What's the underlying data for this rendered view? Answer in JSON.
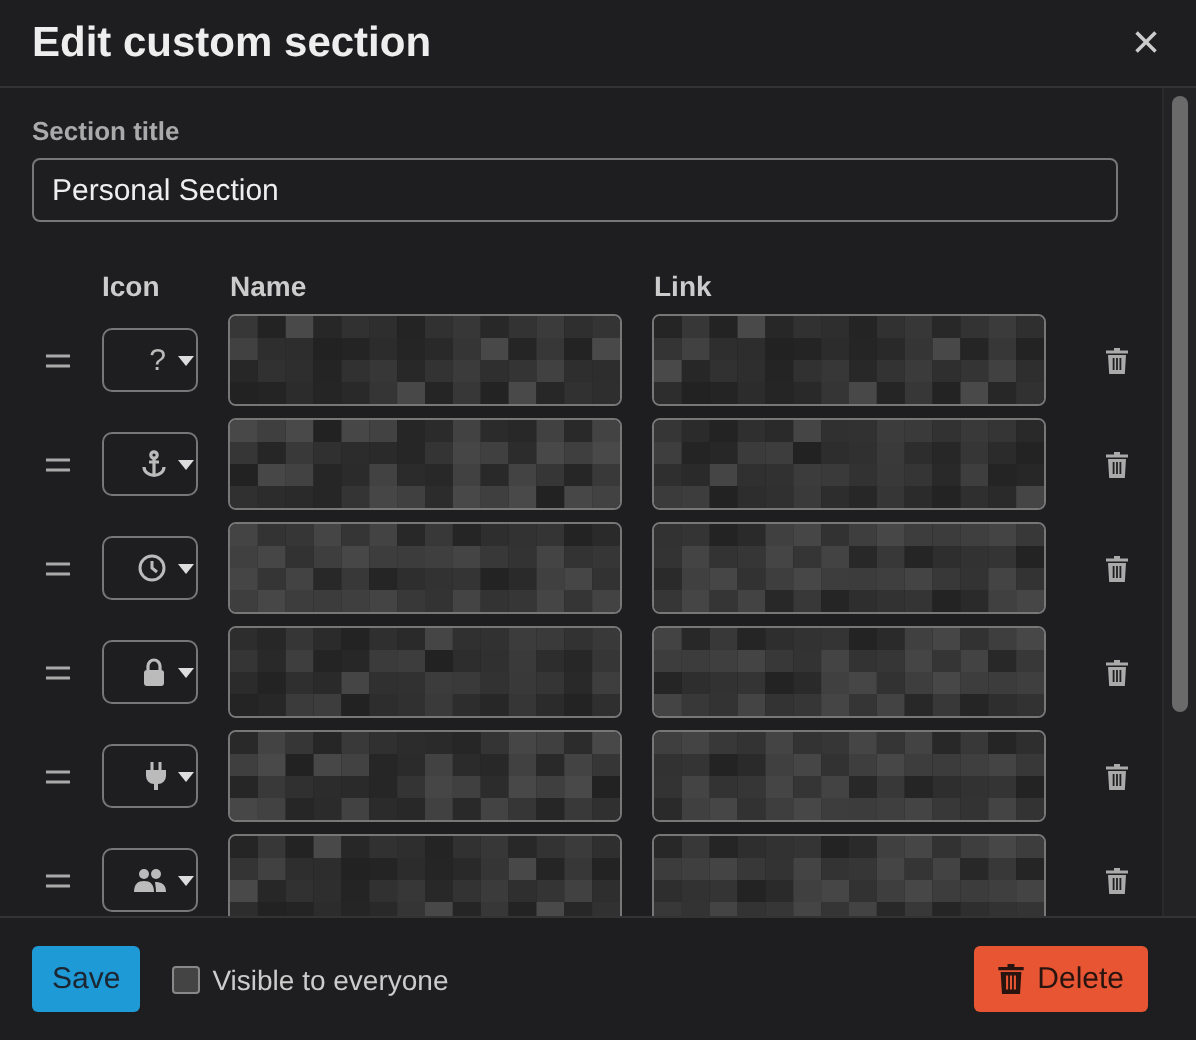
{
  "dialog": {
    "title": "Edit custom section",
    "close": "×"
  },
  "section_title": {
    "label": "Section title",
    "value": "Personal Section"
  },
  "columns": [
    "Icon",
    "Name",
    "Link"
  ],
  "rows": [
    {
      "kind": "glyph",
      "glyph": "?"
    },
    {
      "kind": "anchor"
    },
    {
      "kind": "clock"
    },
    {
      "kind": "lock"
    },
    {
      "kind": "plug"
    },
    {
      "kind": "users"
    }
  ],
  "footer": {
    "save": "Save",
    "visible": {
      "label": "Visible to everyone",
      "checked": false
    },
    "delete": "Delete"
  }
}
